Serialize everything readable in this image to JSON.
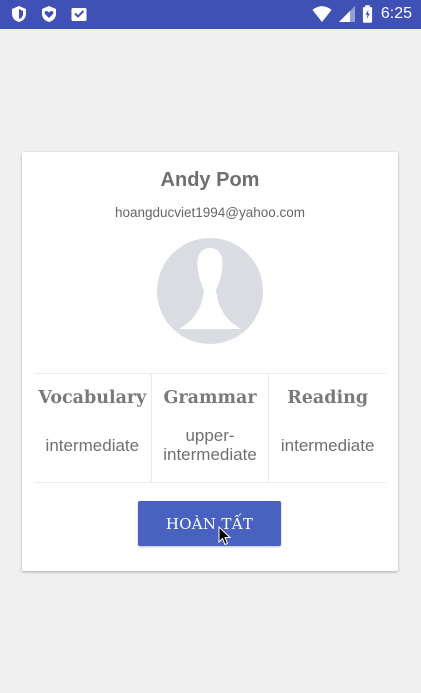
{
  "colors": {
    "status_bar": "#3f51b5",
    "background": "#f0f0f0",
    "button": "#4961bf"
  },
  "status_bar": {
    "time": "6:25",
    "left_icons": [
      "shield-icon",
      "heart-shield-icon",
      "inbox-check-icon"
    ],
    "right_icons": [
      "wifi-icon",
      "signal-icon",
      "battery-icon"
    ]
  },
  "profile": {
    "name": "Andy Pom",
    "email": "hoangducviet1994@yahoo.com"
  },
  "skills": [
    {
      "title": "Vocabulary",
      "level": "intermediate"
    },
    {
      "title": "Grammar",
      "level": "upper-intermediate"
    },
    {
      "title": "Reading",
      "level": "intermediate"
    }
  ],
  "actions": {
    "done_label": "HOÀN TẤT"
  }
}
